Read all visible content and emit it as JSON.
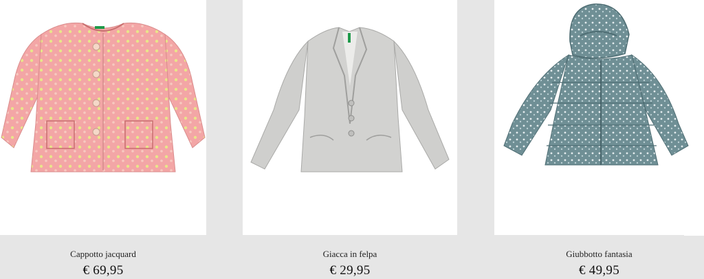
{
  "products": [
    {
      "name": "Cappotto jacquard",
      "price": "€ 69,95",
      "image_icon": "pink-coat-image",
      "color": "#f2a7a4"
    },
    {
      "name": "Giacca in felpa",
      "price": "€ 29,95",
      "image_icon": "grey-blazer-image",
      "color": "#cfcfcd"
    },
    {
      "name": "Giubbotto fantasia",
      "price": "€ 49,95",
      "image_icon": "teal-puffer-jacket-image",
      "color": "#6f8f95"
    }
  ]
}
